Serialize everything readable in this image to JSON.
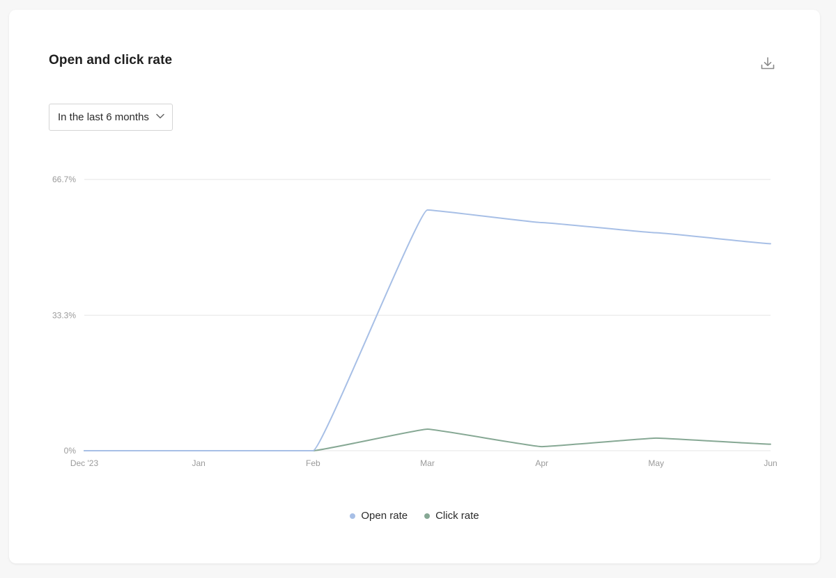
{
  "card": {
    "title": "Open and click rate"
  },
  "toolbar": {
    "download_icon": "download-icon"
  },
  "filter": {
    "selected": "In the last 6 months",
    "chevron_icon": "chevron-down-icon"
  },
  "colors": {
    "open_rate": "#a7bfe6",
    "click_rate": "#86a894",
    "grid": "#e6e6e6",
    "tick_text": "#9a9a9a"
  },
  "chart_data": {
    "type": "line",
    "title": "Open and click rate",
    "xlabel": "",
    "ylabel": "",
    "categories": [
      "Dec '23",
      "Jan",
      "Feb",
      "Mar",
      "Apr",
      "May",
      "Jun"
    ],
    "yticks": [
      "0%",
      "33.3%",
      "66.7%"
    ],
    "ylim": [
      0,
      66.7
    ],
    "grid": true,
    "legend_position": "bottom-center",
    "series": [
      {
        "name": "Open rate",
        "color": "#a7bfe6",
        "values": [
          0,
          0,
          0,
          59.2,
          56.1,
          53.6,
          50.9
        ]
      },
      {
        "name": "Click rate",
        "color": "#86a894",
        "values": [
          0,
          0,
          0,
          5.3,
          1.0,
          3.1,
          1.6
        ]
      }
    ]
  }
}
